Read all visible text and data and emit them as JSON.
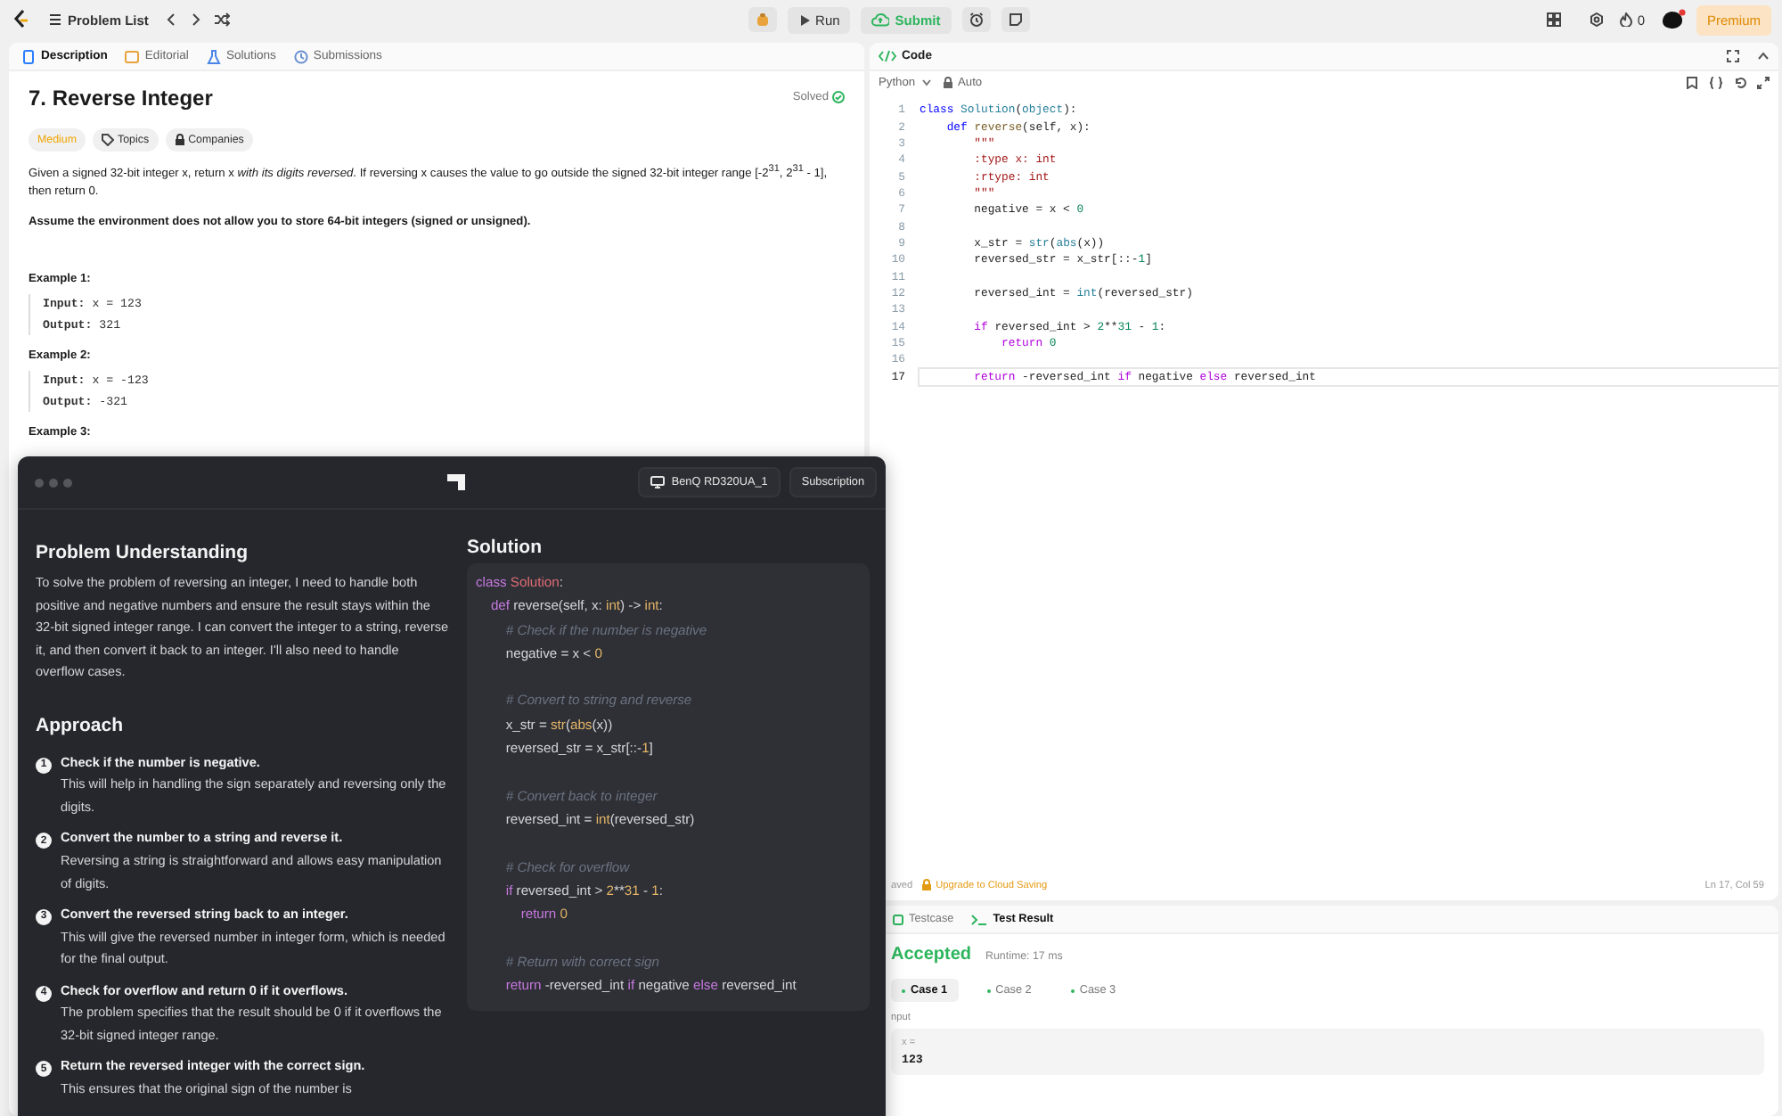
{
  "top_bar": {
    "problem_list": "Problem List",
    "run": "Run",
    "submit": "Submit",
    "streak": "0",
    "premium": "Premium"
  },
  "left_tabs": [
    {
      "label": "Description",
      "selected": true
    },
    {
      "label": "Editorial",
      "selected": false
    },
    {
      "label": "Solutions",
      "selected": false
    },
    {
      "label": "Submissions",
      "selected": false
    }
  ],
  "problem": {
    "title": "7. Reverse Integer",
    "status": "Solved",
    "difficulty": "Medium",
    "tags": [
      "Topics",
      "Companies"
    ],
    "statement": "Given a signed 32-bit integer x, return x *with its digits reversed*. If reversing x causes the value to go outside the signed 32-bit integer range [-2$^{31}$, 2$^{31}$ - 1], then return 0.",
    "note": "Assume the environment does not allow you to store 64-bit integers (signed or unsigned).",
    "examples": [
      {
        "heading": "Example 1:",
        "lines": [
          "**Input:** x = 123",
          "**Output:** 321"
        ]
      },
      {
        "heading": "Example 2:",
        "lines": [
          "**Input:** x = -123",
          "**Output:** -321"
        ]
      },
      {
        "heading": "Example 3:"
      }
    ]
  },
  "overlay": {
    "device": "BenQ RD320UA_1",
    "subscription": "Subscription",
    "understanding": {
      "heading": "Problem Understanding",
      "text": "To solve the problem of reversing an integer, I need to handle both positive and negative numbers and ensure the result stays within the 32-bit signed integer range. I can convert the integer to a string, reverse it, and then convert it back to an integer. I'll also need to handle overflow cases."
    },
    "approach": {
      "heading": "Approach",
      "steps": [
        {
          "n": "1",
          "title": "Check if the number is negative.",
          "text": "This will help in handling the sign separately and reversing only the digits."
        },
        {
          "n": "2",
          "title": "Convert the number to a string and reverse it.",
          "text": "Reversing a string is straightforward and allows easy manipulation of digits."
        },
        {
          "n": "3",
          "title": "Convert the reversed string back to an integer.",
          "text": "This will give the reversed number in integer form, which is needed for the final output."
        },
        {
          "n": "4",
          "title": "Check for overflow and return 0 if it overflows.",
          "text": "The problem specifies that the result should be 0 if it overflows the 32-bit signed integer range."
        },
        {
          "n": "5",
          "title": "Return the reversed integer with the correct sign.",
          "text": "This ensures that the original sign of the number is"
        }
      ]
    },
    "solution": {
      "heading": "Solution",
      "blocks": [
        [
          [
            {
              "text": "class ",
              "kind": "kw"
            },
            {
              "text": "Solution",
              "kind": "cls"
            },
            {
              "text": ":",
              "kind": "p"
            }
          ],
          [
            {
              "text": "    def ",
              "kind": "kw"
            },
            {
              "text": "reverse(self, x: ",
              "kind": "p"
            },
            {
              "text": "int",
              "kind": "bi"
            },
            {
              "text": ") -> ",
              "kind": "p"
            },
            {
              "text": "int",
              "kind": "bi"
            },
            {
              "text": ":",
              "kind": "p"
            }
          ],
          [
            {
              "text": "        # Check if the number is negative",
              "kind": "cm"
            }
          ],
          [
            {
              "text": "        negative = x < ",
              "kind": "p"
            },
            {
              "text": "0",
              "kind": "bi"
            }
          ]
        ],
        [
          [
            {
              "text": "        # Convert to string and reverse",
              "kind": "cm"
            }
          ],
          [
            {
              "text": "        x_str = ",
              "kind": "p"
            },
            {
              "text": "str",
              "kind": "bi"
            },
            {
              "text": "(",
              "kind": "p"
            },
            {
              "text": "abs",
              "kind": "bi"
            },
            {
              "text": "(x))",
              "kind": "p"
            }
          ],
          [
            {
              "text": "        reversed_str = x_str[::-",
              "kind": "p"
            },
            {
              "text": "1",
              "kind": "bi"
            },
            {
              "text": "]",
              "kind": "p"
            }
          ]
        ],
        [
          [
            {
              "text": "        # Convert back to integer",
              "kind": "cm"
            }
          ],
          [
            {
              "text": "        reversed_int = ",
              "kind": "p"
            },
            {
              "text": "int",
              "kind": "bi"
            },
            {
              "text": "(reversed_str)",
              "kind": "p"
            }
          ]
        ],
        [
          [
            {
              "text": "        # Check for overflow",
              "kind": "cm"
            }
          ],
          [
            {
              "text": "        if ",
              "kind": "kw"
            },
            {
              "text": "reversed_int > ",
              "kind": "p"
            },
            {
              "text": "2",
              "kind": "bi"
            },
            {
              "text": "**",
              "kind": "p"
            },
            {
              "text": "31",
              "kind": "bi"
            },
            {
              "text": " - ",
              "kind": "p"
            },
            {
              "text": "1",
              "kind": "bi"
            },
            {
              "text": ":",
              "kind": "p"
            }
          ],
          [
            {
              "text": "            return ",
              "kind": "kw"
            },
            {
              "text": "0",
              "kind": "bi"
            }
          ]
        ],
        [
          [
            {
              "text": "        # Return with correct sign",
              "kind": "cm"
            }
          ],
          [
            {
              "text": "        return ",
              "kind": "kw"
            },
            {
              "text": "-reversed_int ",
              "kind": "p"
            },
            {
              "text": "if ",
              "kind": "kw"
            },
            {
              "text": "negative ",
              "kind": "p"
            },
            {
              "text": "else ",
              "kind": "kw"
            },
            {
              "text": "reversed_int",
              "kind": "p"
            }
          ]
        ]
      ]
    }
  },
  "editor": {
    "header": "Code",
    "language": "Python",
    "mode": "Auto",
    "lines": [
      {
        "n": "1",
        "current": false,
        "tokens": [
          {
            "text": "class ",
            "kind": "kw"
          },
          {
            "text": "Solution",
            "kind": "type"
          },
          {
            "text": "(",
            "kind": "p"
          },
          {
            "text": "object",
            "kind": "type"
          },
          {
            "text": "):",
            "kind": "p"
          }
        ]
      },
      {
        "n": "2",
        "current": false,
        "tokens": [
          {
            "text": "    def ",
            "kind": "kw"
          },
          {
            "text": "reverse",
            "kind": "fn"
          },
          {
            "text": "(self, x):",
            "kind": "p"
          }
        ]
      },
      {
        "n": "3",
        "current": false,
        "tokens": [
          {
            "text": "        \"\"\"",
            "kind": "str"
          }
        ]
      },
      {
        "n": "4",
        "current": false,
        "tokens": [
          {
            "text": "        :type x: int",
            "kind": "str"
          }
        ]
      },
      {
        "n": "5",
        "current": false,
        "tokens": [
          {
            "text": "        :rtype: int",
            "kind": "str"
          }
        ]
      },
      {
        "n": "6",
        "current": false,
        "tokens": [
          {
            "text": "        \"\"\"",
            "kind": "str"
          }
        ]
      },
      {
        "n": "7",
        "current": false,
        "tokens": [
          {
            "text": "        negative = x < ",
            "kind": "p"
          },
          {
            "text": "0",
            "kind": "num"
          }
        ]
      },
      {
        "n": "8",
        "current": false
      },
      {
        "n": "9",
        "current": false,
        "tokens": [
          {
            "text": "        x_str = ",
            "kind": "p"
          },
          {
            "text": "str",
            "kind": "type"
          },
          {
            "text": "(",
            "kind": "p"
          },
          {
            "text": "abs",
            "kind": "type"
          },
          {
            "text": "(x))",
            "kind": "p"
          }
        ]
      },
      {
        "n": "10",
        "current": false,
        "tokens": [
          {
            "text": "        reversed_str = x_str[::-",
            "kind": "p"
          },
          {
            "text": "1",
            "kind": "num"
          },
          {
            "text": "]",
            "kind": "p"
          }
        ]
      },
      {
        "n": "11",
        "current": false
      },
      {
        "n": "12",
        "current": false,
        "tokens": [
          {
            "text": "        reversed_int = ",
            "kind": "p"
          },
          {
            "text": "int",
            "kind": "type"
          },
          {
            "text": "(reversed_str)",
            "kind": "p"
          }
        ]
      },
      {
        "n": "13",
        "current": false
      },
      {
        "n": "14",
        "current": false,
        "tokens": [
          {
            "text": "        if ",
            "kind": "ctl"
          },
          {
            "text": "reversed_int > ",
            "kind": "p"
          },
          {
            "text": "2",
            "kind": "num"
          },
          {
            "text": "**",
            "kind": "p"
          },
          {
            "text": "31",
            "kind": "num"
          },
          {
            "text": " - ",
            "kind": "p"
          },
          {
            "text": "1",
            "kind": "num"
          },
          {
            "text": ":",
            "kind": "p"
          }
        ]
      },
      {
        "n": "15",
        "current": false,
        "tokens": [
          {
            "text": "            return ",
            "kind": "ctl"
          },
          {
            "text": "0",
            "kind": "num"
          }
        ]
      },
      {
        "n": "16",
        "current": false
      },
      {
        "n": "17",
        "current": true,
        "tokens": [
          {
            "text": "        return ",
            "kind": "ctl"
          },
          {
            "text": "-reversed_int ",
            "kind": "p"
          },
          {
            "text": "if ",
            "kind": "ctl"
          },
          {
            "text": "negative ",
            "kind": "p"
          },
          {
            "text": "else ",
            "kind": "ctl"
          },
          {
            "text": "reversed_int",
            "kind": "p"
          }
        ]
      }
    ],
    "status": {
      "saved": "aved",
      "upgrade": "Upgrade to Cloud Saving",
      "position": "Ln 17, Col 59"
    }
  },
  "test": {
    "tabs": [
      {
        "label": "Testcase",
        "selected": false
      },
      {
        "label": "Test Result",
        "selected": true
      }
    ],
    "verdict": "Accepted",
    "runtime": "Runtime: 17 ms",
    "cases": [
      {
        "label": "Case 1",
        "selected": true
      },
      {
        "label": "Case 2",
        "selected": false
      },
      {
        "label": "Case 3",
        "selected": false
      }
    ],
    "input_label": "nput",
    "input_name": "x =",
    "input_value": "123"
  }
}
